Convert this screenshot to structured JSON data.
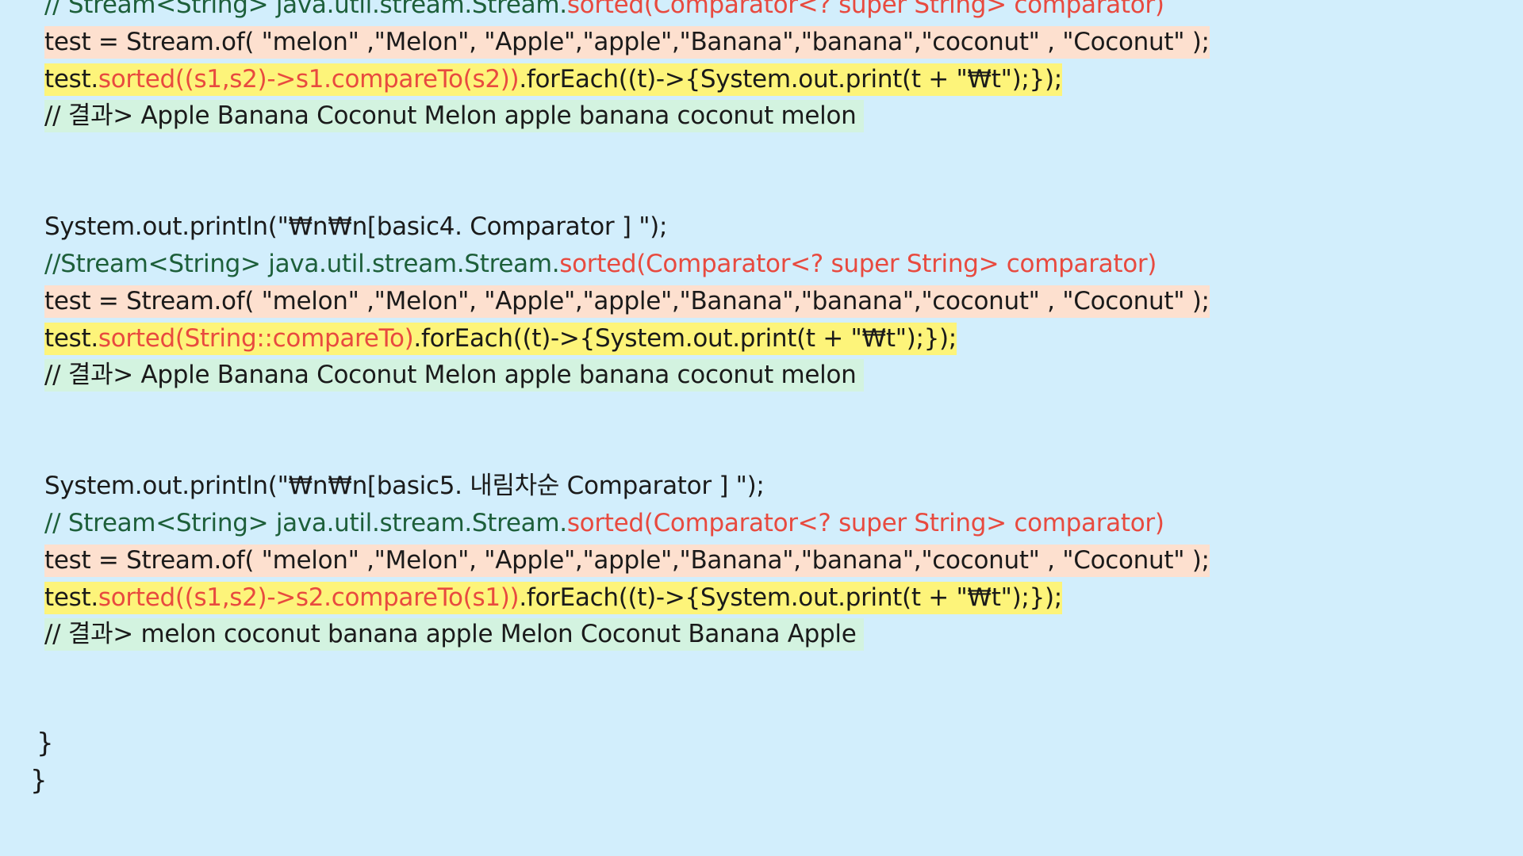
{
  "block1": {
    "comment_prefix": "// Stream<String> java.util.stream.Stream.",
    "comment_method": "sorted(Comparator<? super String> comparator)",
    "test_line": "test = Stream.of( \"melon\" ,\"Melon\", \"Apple\",\"apple\",\"Banana\",\"banana\",\"coconut\" , \"Coconut\" );",
    "call_prefix": "test.",
    "call_sorted": "sorted((s1,s2)->s1.compareTo(s2))",
    "call_suffix": ".forEach((t)->{System.out.print(t + \"₩t\");});",
    "result": "// 결과> Apple  Banana  Coconut  Melon  apple  banana  coconut  melon"
  },
  "block2": {
    "println": "System.out.println(\"₩n₩n[basic4. Comparator ] \");",
    "comment_prefix": "//Stream<String> java.util.stream.Stream.",
    "comment_method": "sorted(Comparator<? super String> comparator)",
    "test_line": "test = Stream.of( \"melon\" ,\"Melon\", \"Apple\",\"apple\",\"Banana\",\"banana\",\"coconut\" , \"Coconut\" );",
    "call_prefix": "test.",
    "call_sorted": "sorted(String::compareTo)",
    "call_suffix": ".forEach((t)->{System.out.print(t + \"₩t\");});",
    "result": "// 결과>  Apple  Banana  Coconut  Melon  apple  banana  coconut  melon"
  },
  "block3": {
    "println": "System.out.println(\"₩n₩n[basic5. 내림차순 Comparator ] \");",
    "comment_prefix": "// Stream<String> java.util.stream.Stream.",
    "comment_method": "sorted(Comparator<? super String> comparator)",
    "test_line": "test = Stream.of( \"melon\" ,\"Melon\", \"Apple\",\"apple\",\"Banana\",\"banana\",\"coconut\" , \"Coconut\" );",
    "call_prefix": "test.",
    "call_sorted": "sorted((s1,s2)->s2.compareTo(s1))",
    "call_suffix": ".forEach((t)->{System.out.print(t + \"₩t\");});",
    "result": "// 결과> melon  coconut  banana  apple  Melon  Coconut  Banana   Apple"
  },
  "closing": {
    "inner_brace": "}",
    "outer_brace": "}"
  },
  "colors": {
    "background": "#d2eefc",
    "peach_highlight": "#fde0cf",
    "yellow_highlight": "#fdf47a",
    "mint_highlight": "#d3f3e0",
    "comment_green": "#1d5f3a",
    "method_red": "#e84a3f"
  }
}
